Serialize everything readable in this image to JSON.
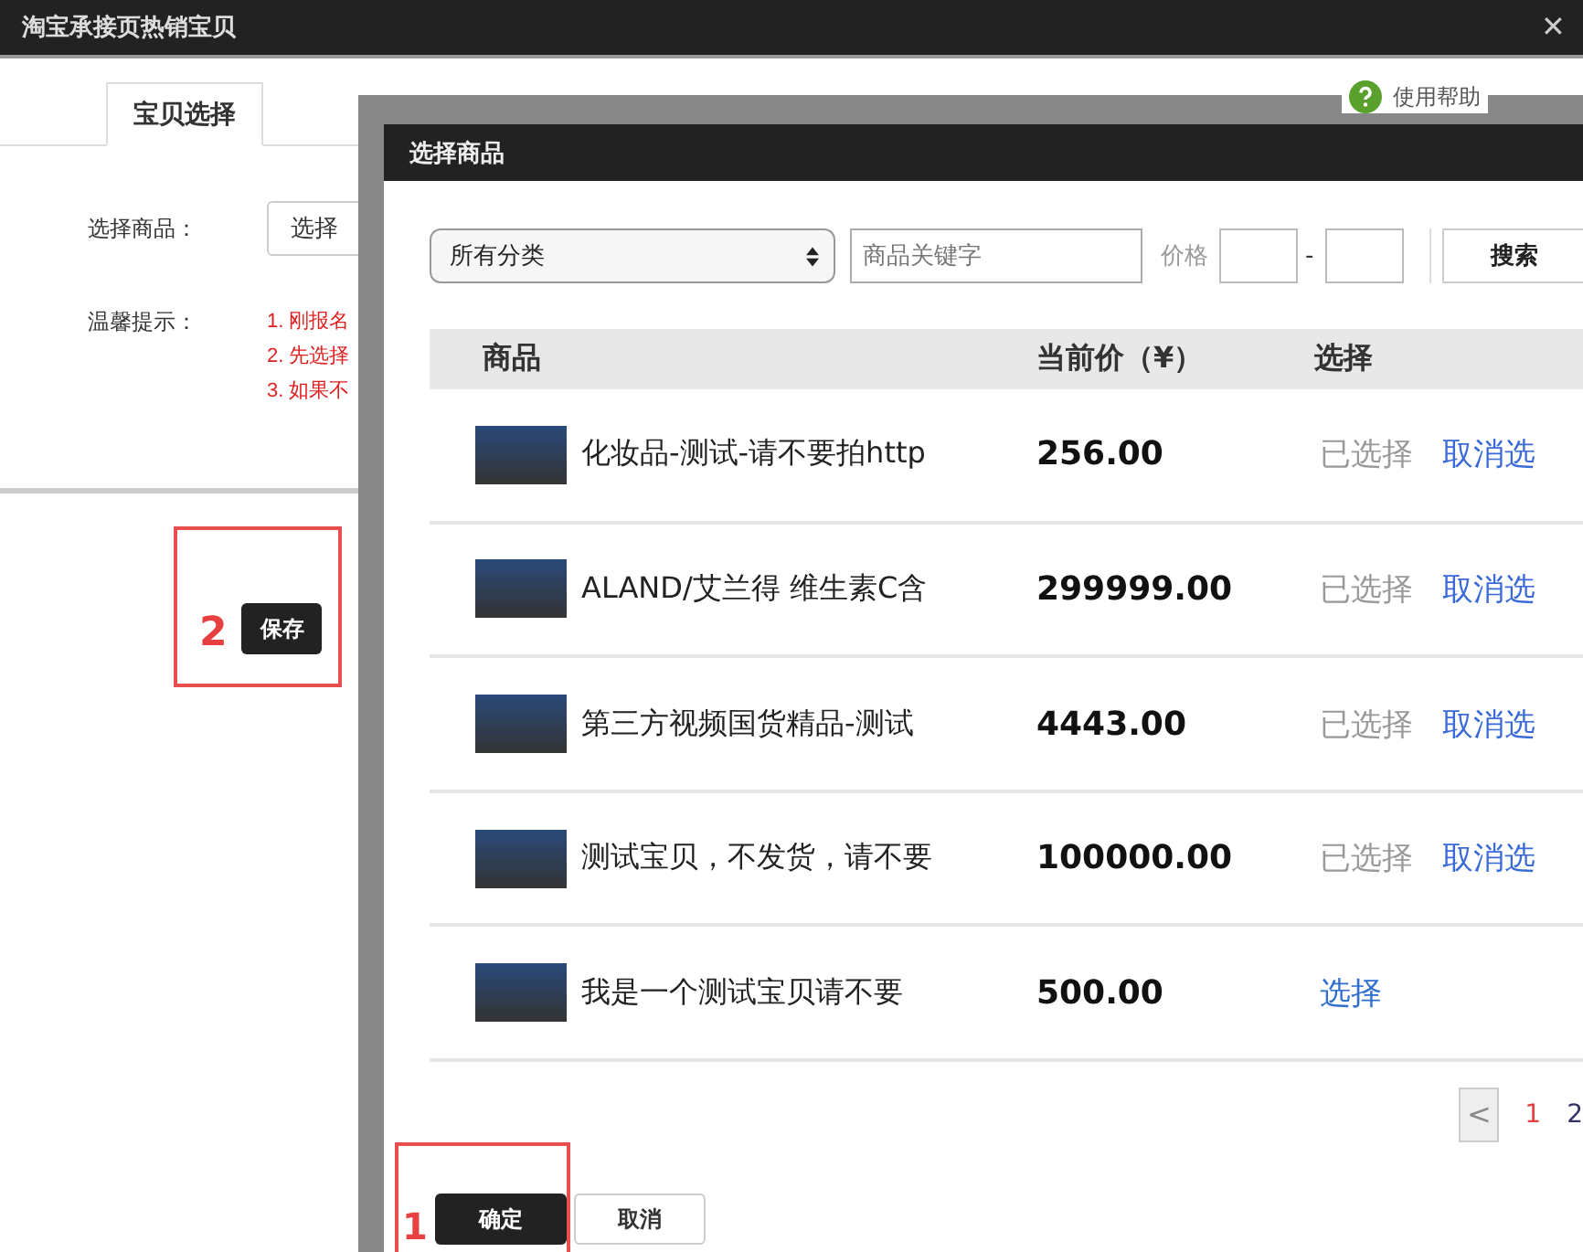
{
  "window": {
    "title": "淘宝承接页热销宝贝",
    "close": "✕"
  },
  "tabs": [
    {
      "label": "宝贝选择",
      "selected": true
    }
  ],
  "help": {
    "label": "使用帮助"
  },
  "form": {
    "product_label": "选择商品：",
    "product_select": "选择",
    "tips_label": "温馨提示：",
    "tips": [
      "1. 刚报名",
      "2. 先选择",
      "3. 如果不"
    ]
  },
  "save_button": "保存",
  "callouts": [
    {
      "number": "2"
    },
    {
      "number": "1"
    }
  ],
  "dialog": {
    "title": "选择商品",
    "toolbar": {
      "category": "所有分类",
      "keyword_placeholder": "商品关键字",
      "price_label": "价格",
      "separator": "-",
      "search_button": "搜索"
    },
    "table": {
      "columns": [
        "商品",
        "当前价（¥）",
        "选择"
      ],
      "rows": [
        {
          "name": "化妆品-测试-请不要拍http",
          "price": "256.00",
          "selected": true,
          "status": "已选择",
          "action": "取消选"
        },
        {
          "name": "ALAND/艾兰得 维生素C含",
          "price": "299999.00",
          "selected": true,
          "status": "已选择",
          "action": "取消选"
        },
        {
          "name": "第三方视频国货精品-测试",
          "price": "4443.00",
          "selected": true,
          "status": "已选择",
          "action": "取消选"
        },
        {
          "name": "测试宝贝，不发货，请不要",
          "price": "100000.00",
          "selected": true,
          "status": "已选择",
          "action": "取消选"
        },
        {
          "name": "我是一个测试宝贝请不要",
          "price": "500.00",
          "selected": false,
          "select_link": "选择"
        }
      ]
    },
    "pagination": {
      "prev": "<",
      "pages": [
        {
          "label": "1",
          "selected": true
        },
        {
          "label": "2",
          "selected": false
        }
      ]
    },
    "buttons": [
      "确定",
      "取消"
    ]
  }
}
